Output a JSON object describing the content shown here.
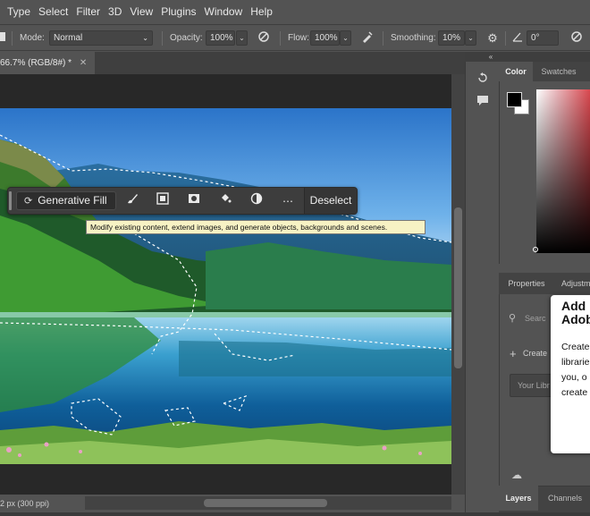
{
  "menu": [
    "Type",
    "Select",
    "Filter",
    "3D",
    "View",
    "Plugins",
    "Window",
    "Help"
  ],
  "options": {
    "mode_label": "Mode:",
    "mode_value": "Normal",
    "opacity_label": "Opacity:",
    "opacity_value": "100%",
    "flow_label": "Flow:",
    "flow_value": "100%",
    "smoothing_label": "Smoothing:",
    "smoothing_value": "10%",
    "angle_value": "0°"
  },
  "document": {
    "tab_title": "66.7% (RGB/8#) *",
    "status": "2 px (300 ppi)"
  },
  "taskbar": {
    "generative_fill": "Generative Fill",
    "deselect": "Deselect",
    "tooltip": "Modify existing content, extend images, and generate objects, backgrounds and scenes.",
    "icons": [
      "brush-icon",
      "mask-select-icon",
      "mask-icon",
      "fill-bucket-icon",
      "invert-icon",
      "more-icon"
    ]
  },
  "panels": {
    "color_tab": "Color",
    "swatches_tab": "Swatches",
    "properties_tab": "Properties",
    "adjustments_tab": "Adjustm",
    "search_placeholder": "Searc",
    "create_label": "Create",
    "your_library": "Your Libr",
    "layers_tab": "Layers",
    "channels_tab": "Channels",
    "popover_title": "Add\nAdob",
    "popover_body": "Create\nlibrarie\nyou, o\ncreate"
  },
  "colors": {
    "foreground": "#000000",
    "background": "#ffffff",
    "tooltip_bg": "#f7f2c4",
    "ui_panel": "#535353",
    "canvas_bg": "#282828"
  }
}
